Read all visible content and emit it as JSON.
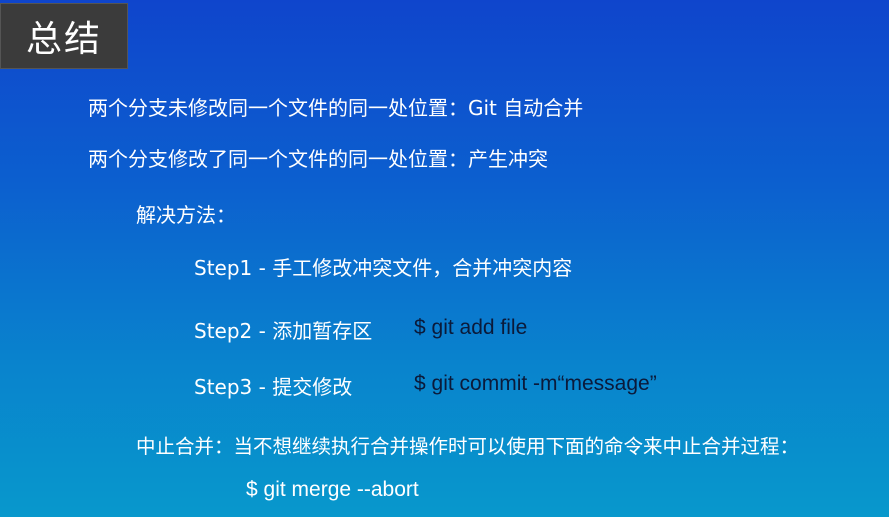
{
  "slide": {
    "title": "总结",
    "line1": "两个分支未修改同一个文件的同一处位置：Git 自动合并",
    "line2": "两个分支修改了同一个文件的同一处位置：产生冲突",
    "solution_heading": "解决方法：",
    "steps": [
      {
        "label": "Step1 - 手工修改冲突文件，合并冲突内容",
        "command": ""
      },
      {
        "label": "Step2 - 添加暂存区",
        "command": "$ git add file"
      },
      {
        "label": "Step3 - 提交修改",
        "command": "$ git commit -m“message”"
      }
    ],
    "abort_text": "中止合并：当不想继续执行合并操作时可以使用下面的命令来中止合并过程：",
    "abort_command": "$ git merge --abort"
  },
  "colors": {
    "background_top": "#0f45cc",
    "background_bottom": "#0898cc",
    "title_box": "#3b3b3b",
    "command_text": "#0b1a3a",
    "text": "#ffffff"
  }
}
